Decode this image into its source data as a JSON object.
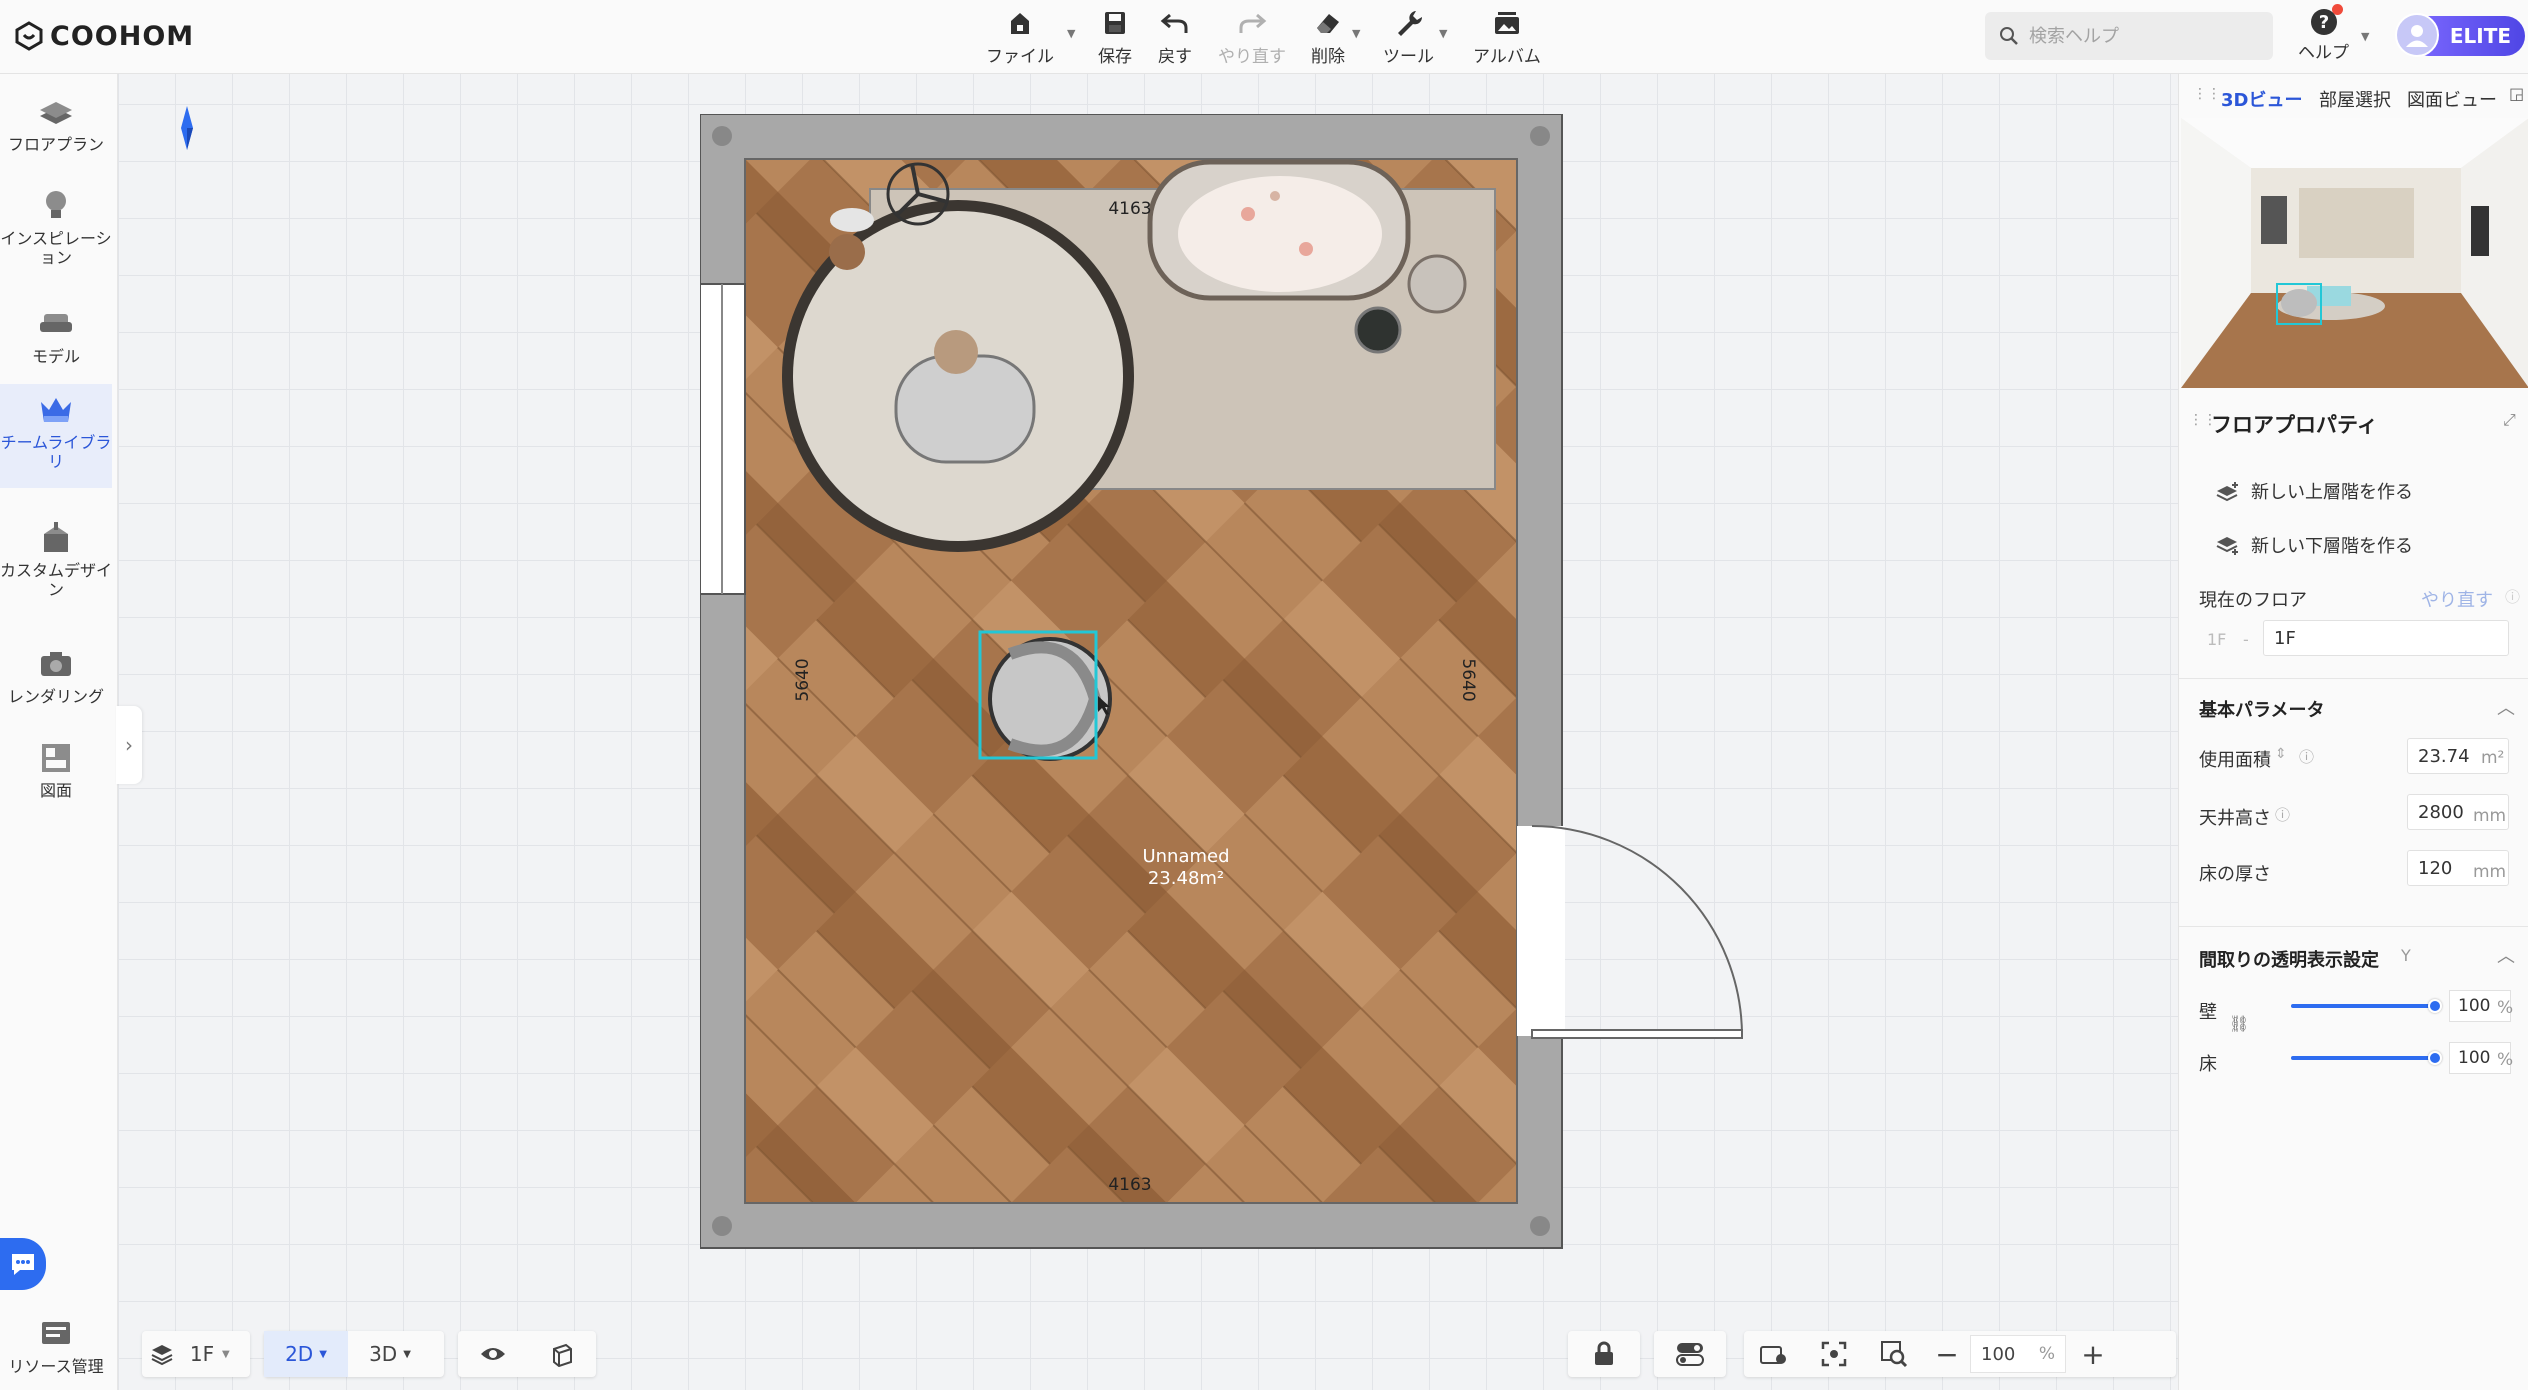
{
  "app": {
    "name": "COOHOM"
  },
  "toolbar": {
    "file": "ファイル",
    "save": "保存",
    "undo": "戻す",
    "redo": "やり直す",
    "delete": "削除",
    "tools": "ツール",
    "album": "アルバム"
  },
  "search": {
    "placeholder": "検索ヘルプ"
  },
  "help": {
    "label": "ヘルプ"
  },
  "account": {
    "badge": "ELITE"
  },
  "leftnav": {
    "floorplan": "フロアプラン",
    "inspiration": "インスピレーション",
    "model": "モデル",
    "team_library": "チームライブラリ",
    "custom_design": "カスタムデザイン",
    "rendering": "レンダリング",
    "drawing": "図面",
    "resource": "リソース管理"
  },
  "plan": {
    "dim_top": "4163",
    "dim_bottom": "4163",
    "dim_left": "5640",
    "dim_right": "5640",
    "room_name": "Unnamed",
    "room_area": "23.48m²"
  },
  "rightpanel": {
    "tabs": [
      "3Dビュー",
      "部屋選択",
      "図面ビュー"
    ],
    "title": "フロアプロパティ",
    "new_upper": "新しい上層階を作る",
    "new_lower": "新しい下層階を作る",
    "current_floor_label": "現在のフロア",
    "redo_link": "やり直す",
    "floor_prefix": "1F",
    "floor_dash": "-",
    "floor_value": "1F",
    "basic_params": "基本パラメータ",
    "usable_area_label": "使用面積",
    "usable_area_value": "23.74",
    "usable_area_unit": "m²",
    "ceiling_label": "天井高さ",
    "ceiling_value": "2800",
    "ceiling_unit": "mm",
    "floor_thickness_label": "床の厚さ",
    "floor_thickness_value": "120",
    "floor_thickness_unit": "mm",
    "transparency_title": "間取りの透明表示設定",
    "transparency_key": "Y",
    "wall_label": "壁",
    "wall_value": "100",
    "floor_label": "床",
    "floor_value_pct": "100",
    "pct_unit": "%"
  },
  "bottombar": {
    "floor": "1F",
    "view2d": "2D",
    "view3d": "3D",
    "zoom": "100",
    "zoom_unit": "%"
  },
  "sliders": {
    "wall_opacity": 1.0,
    "floor_opacity": 1.0
  },
  "colors": {
    "accent": "#2d6cf0",
    "wall": "#a6a6a6",
    "floor_wood": "#a7754c",
    "selection": "#22c7d6"
  }
}
